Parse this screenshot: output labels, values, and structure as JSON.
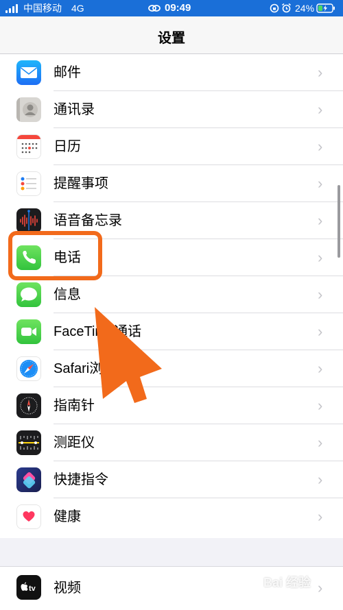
{
  "status_bar": {
    "carrier": "中国移动",
    "network": "4G",
    "time": "09:49",
    "battery": "24%"
  },
  "header": {
    "title": "设置"
  },
  "settings_group_1": [
    {
      "label": "邮件",
      "icon": "mail-icon"
    },
    {
      "label": "通讯录",
      "icon": "contacts-icon"
    },
    {
      "label": "日历",
      "icon": "calendar-icon"
    },
    {
      "label": "提醒事项",
      "icon": "reminders-icon"
    },
    {
      "label": "语音备忘录",
      "icon": "voice-memos-icon"
    },
    {
      "label": "电话",
      "icon": "phone-icon"
    },
    {
      "label": "信息",
      "icon": "messages-icon"
    },
    {
      "label": "FaceTime通话",
      "icon": "facetime-icon"
    },
    {
      "label": "Safari浏览器",
      "icon": "safari-icon"
    },
    {
      "label": "指南针",
      "icon": "compass-icon"
    },
    {
      "label": "测距仪",
      "icon": "measure-icon"
    },
    {
      "label": "快捷指令",
      "icon": "shortcuts-icon"
    },
    {
      "label": "健康",
      "icon": "health-icon"
    }
  ],
  "settings_group_2": [
    {
      "label": "视频",
      "icon": "apple-tv-icon"
    }
  ],
  "overlay": {
    "highlight_color": "#f26a1b",
    "arrow_color": "#f26a1b",
    "watermark": "Bai 经验"
  },
  "colors": {
    "status_bar": "#1a6fd8",
    "separator": "#dcdce0",
    "chevron": "#c4c4c9"
  }
}
